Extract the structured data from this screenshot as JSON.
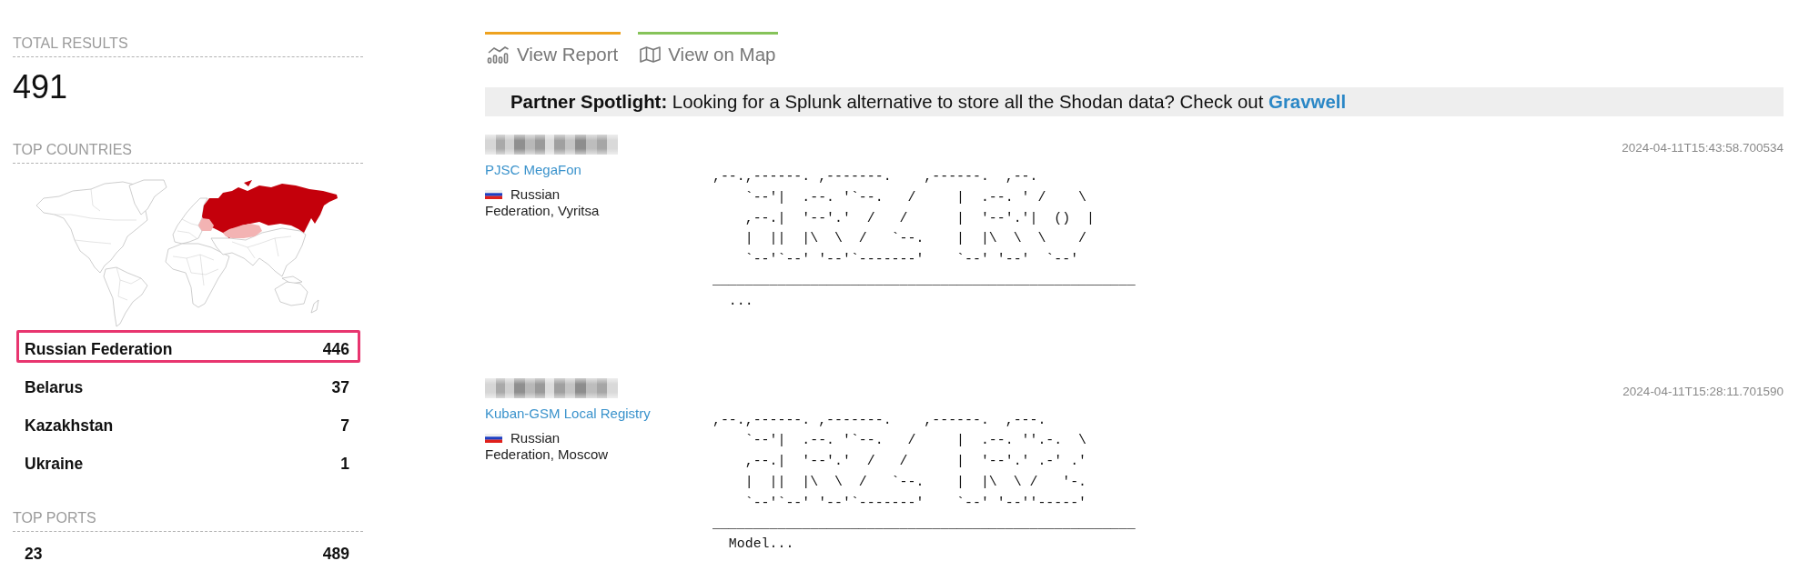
{
  "sidebar": {
    "total": {
      "label": "TOTAL RESULTS",
      "value": "491"
    },
    "countries": {
      "label": "TOP COUNTRIES",
      "items": [
        {
          "name": "Russian Federation",
          "count": "446",
          "highlighted": true
        },
        {
          "name": "Belarus",
          "count": "37",
          "highlighted": false
        },
        {
          "name": "Kazakhstan",
          "count": "7",
          "highlighted": false
        },
        {
          "name": "Ukraine",
          "count": "1",
          "highlighted": false
        }
      ]
    },
    "ports": {
      "label": "TOP PORTS",
      "items": [
        {
          "name": "23",
          "count": "489",
          "highlighted": false
        }
      ]
    }
  },
  "tabs": [
    {
      "kind": "report",
      "label": "View Report",
      "color": "#eea21f"
    },
    {
      "kind": "map",
      "label": "View on Map",
      "color": "#86c35a"
    }
  ],
  "spotlight": {
    "text": "**Partner Spotlight:** Looking for a Splunk alternative to store all the Shodan data? Check out",
    "link": "Gravwell"
  },
  "results": [
    {
      "ip_redacted": true,
      "timestamp": "2024-04-11T15:43:58.700534",
      "org": "PJSC MegaFon",
      "location_lines": [
        "Russian",
        "Federation, Vyritsa"
      ],
      "banner": ",--.,------. ,-------.    ,------.  ,--.\n    `--'|  .--. '`--.   /     |  .--. ' /    \\\n    ,--.|  '--'.'  /   /      |  '--'.'|  ()  |\n    |  ||  |\\  \\  /   `--.    |  |\\  \\  \\    /\n    `--'`--' '--'`-------'    `--' '--'  `--'\n____________________________________________________\n  ..."
    },
    {
      "ip_redacted": true,
      "timestamp": "2024-04-11T15:28:11.701590",
      "org": "Kuban-GSM Local Registry",
      "location_lines": [
        "Russian",
        "Federation, Moscow"
      ],
      "banner": ",--.,------. ,-------.    ,------.  ,---.\n    `--'|  .--. '`--.   /     |  .--. ''.-.  \\\n    ,--.|  '--'.'  /   /      |  '--'.' .-' .'\n    |  ||  |\\  \\  /   `--.    |  |\\  \\ /   '-.\n    `--'`--' '--'`-------'    `--' '--''-----'\n____________________________________________________\n  Model..."
    }
  ]
}
